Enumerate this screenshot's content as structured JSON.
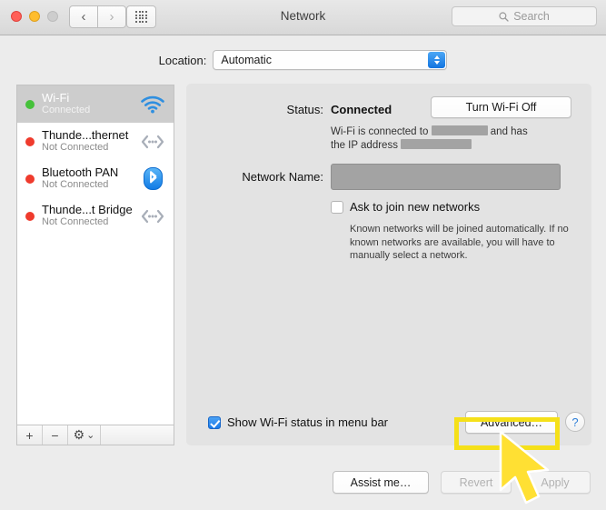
{
  "window": {
    "title": "Network",
    "traffic_lights": [
      "close",
      "minimize",
      "zoom-disabled"
    ],
    "nav_back_icon": "chevron-left-icon",
    "nav_forward_icon": "chevron-right-icon",
    "grid_icon": "show-all-grid-icon",
    "search": {
      "placeholder": "Search",
      "icon": "search-icon"
    }
  },
  "location": {
    "label": "Location:",
    "value": "Automatic",
    "options": [
      "Automatic"
    ]
  },
  "sidebar": {
    "services": [
      {
        "name": "Wi-Fi",
        "status": "Connected",
        "dot": "green",
        "icon": "wifi-icon",
        "selected": true
      },
      {
        "name": "Thunde...thernet",
        "status": "Not Connected",
        "dot": "red",
        "icon": "thunderbolt-ethernet-icon",
        "selected": false
      },
      {
        "name": "Bluetooth PAN",
        "status": "Not Connected",
        "dot": "red",
        "icon": "bluetooth-icon",
        "selected": false
      },
      {
        "name": "Thunde...t Bridge",
        "status": "Not Connected",
        "dot": "red",
        "icon": "thunderbolt-bridge-icon",
        "selected": false
      }
    ],
    "toolbar": {
      "add_label": "+",
      "remove_label": "−",
      "gear_label": "⚙",
      "gear_chevron": "⌄"
    }
  },
  "main": {
    "status_label": "Status:",
    "status_value": "Connected",
    "turn_wifi_button": "Turn Wi-Fi Off",
    "connection_text_prefix": "Wi-Fi is connected to",
    "connection_text_middle": "and has",
    "connection_text_suffix": "the IP address",
    "redacted_network": "",
    "redacted_ip": "",
    "network_name_label": "Network Name:",
    "network_name_value": "",
    "ask_join_label": "Ask to join new networks",
    "ask_join_checked": false,
    "helper_text": "Known networks will be joined automatically. If no known networks are available, you will have to manually select a network.",
    "show_status_label": "Show Wi-Fi status in menu bar",
    "show_status_checked": true,
    "advanced_button": "Advanced…",
    "help_button": "?"
  },
  "footer": {
    "assist_button": "Assist me…",
    "revert_button": "Revert",
    "apply_button": "Apply",
    "revert_disabled": true,
    "apply_disabled": true
  },
  "annotation": {
    "highlight_color": "#f5e019",
    "highlight_target": "advanced-button",
    "cursor_color": "#ffe033",
    "cursor_type": "arrow-pointer"
  }
}
